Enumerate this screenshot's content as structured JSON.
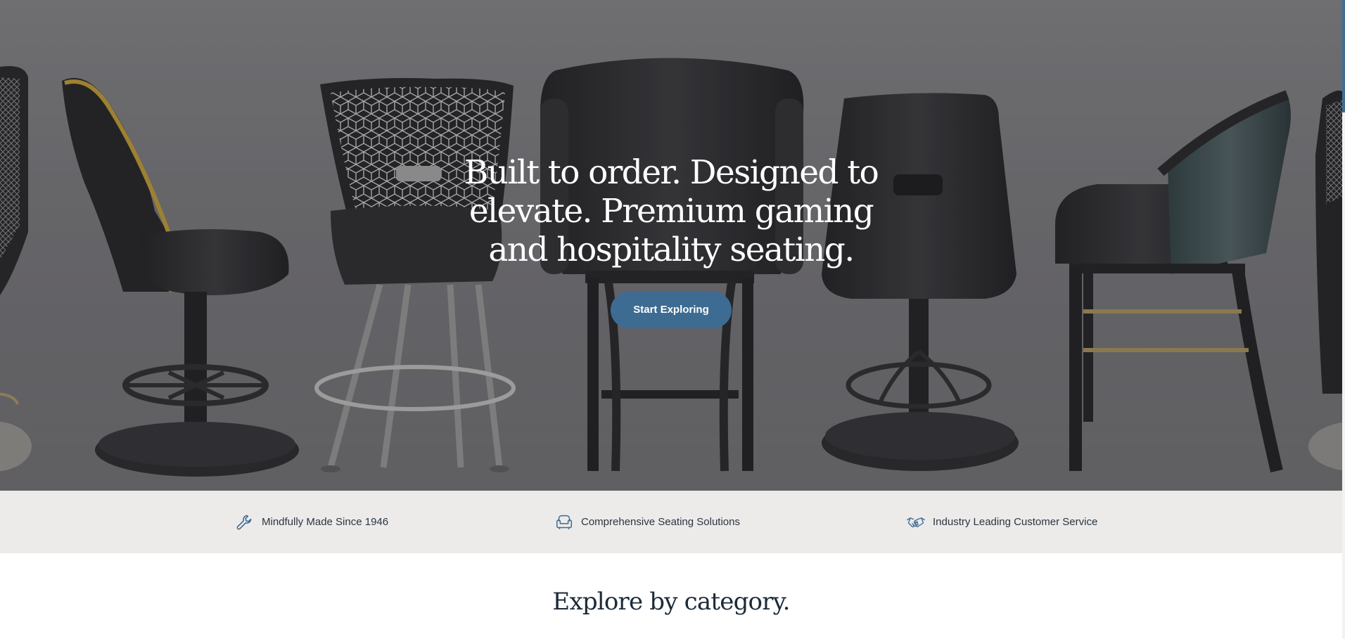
{
  "hero": {
    "title": "Built to order. Designed to elevate. Premium gaming and hospitality seating.",
    "cta_label": "Start Exploring"
  },
  "features": [
    {
      "icon": "wrench-icon",
      "label": "Mindfully Made Since 1946"
    },
    {
      "icon": "armchair-icon",
      "label": "Comprehensive Seating Solutions"
    },
    {
      "icon": "handshake-icon",
      "label": "Industry Leading Customer Service"
    }
  ],
  "category": {
    "title": "Explore by category."
  },
  "colors": {
    "accent": "#3d6b92",
    "strip_bg": "#ecebea",
    "heading": "#1d2a38"
  }
}
